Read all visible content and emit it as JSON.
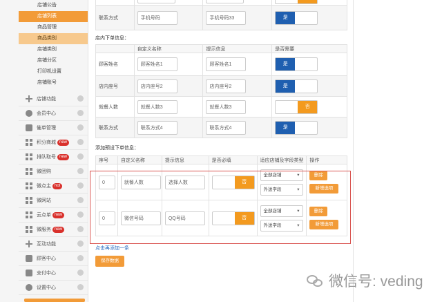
{
  "sidebar": {
    "sub_items": [
      "店铺公告",
      "店铺列表",
      "商品管理",
      "商品类别",
      "店铺类别",
      "店铺分区",
      "打印机设置",
      "店铺账号"
    ],
    "items": [
      {
        "label": "店铺功能",
        "icon": "plus-icon",
        "badge": ""
      },
      {
        "label": "会员中心",
        "icon": "pie-icon",
        "badge": ""
      },
      {
        "label": "催单管理",
        "icon": "box-icon",
        "badge": ""
      },
      {
        "label": "积分商城",
        "icon": "grid-icon",
        "badge": "new"
      },
      {
        "label": "排队取号",
        "icon": "grid-icon",
        "badge": "new"
      },
      {
        "label": "微团购",
        "icon": "grid-icon",
        "badge": ""
      },
      {
        "label": "微点主",
        "icon": "grid-icon",
        "badge": "hot"
      },
      {
        "label": "微网站",
        "icon": "grid-icon",
        "badge": ""
      },
      {
        "label": "云点单",
        "icon": "grid-icon",
        "badge": "new"
      },
      {
        "label": "微服务",
        "icon": "grid-icon",
        "badge": "new"
      },
      {
        "label": "互动功能",
        "icon": "plus-icon",
        "badge": ""
      },
      {
        "label": "顾客中心",
        "icon": "box-icon",
        "badge": ""
      },
      {
        "label": "支付中心",
        "icon": "box-icon",
        "badge": ""
      },
      {
        "label": "设置中心",
        "icon": "gear-icon",
        "badge": ""
      }
    ]
  },
  "top_row": {
    "label": "联系方式",
    "input1": "手机号码",
    "input2": "手机号码33",
    "toggle": "是"
  },
  "instore": {
    "title": "店内下单信息：",
    "headers": [
      "",
      "自定义名称",
      "提示信息",
      "是否需要"
    ],
    "rows": [
      {
        "label": "顾客姓名",
        "name": "顾客姓名1",
        "hint": "顾客姓名1",
        "toggle": "是",
        "on": true
      },
      {
        "label": "店内座号",
        "name": "店内座号2",
        "hint": "店内座号2",
        "toggle": "是",
        "on": true
      },
      {
        "label": "就餐人数",
        "name": "就餐人数3",
        "hint": "就餐人数3",
        "toggle": "否",
        "on": false
      },
      {
        "label": "联系方式",
        "name": "联系方式4",
        "hint": "联系方式4",
        "toggle": "是",
        "on": true
      }
    ]
  },
  "preorder": {
    "title": "添加预设下单信息：",
    "headers": [
      "序号",
      "自定义名称",
      "提示信息",
      "是否必填",
      "适应店铺及字段类型",
      "操作"
    ],
    "rows": [
      {
        "seq": "0",
        "name": "就餐人数",
        "hint": "选择人数",
        "toggle": "否",
        "shop": "全部店铺",
        "field": "外送字段",
        "delete": "删除",
        "add_option": "新增选项"
      },
      {
        "seq": "0",
        "name": "微信号码",
        "hint": "QQ号码",
        "toggle": "否",
        "shop": "全部店铺",
        "field": "外送字段",
        "delete": "删除",
        "add_option": "新增选项"
      }
    ],
    "add_link": "点击再添加一条",
    "save": "保存数据"
  },
  "watermark": "微信号: veding",
  "colors": {
    "orange": "#f29b38",
    "blue": "#1f5fb0",
    "highlight": "#d9534f"
  }
}
